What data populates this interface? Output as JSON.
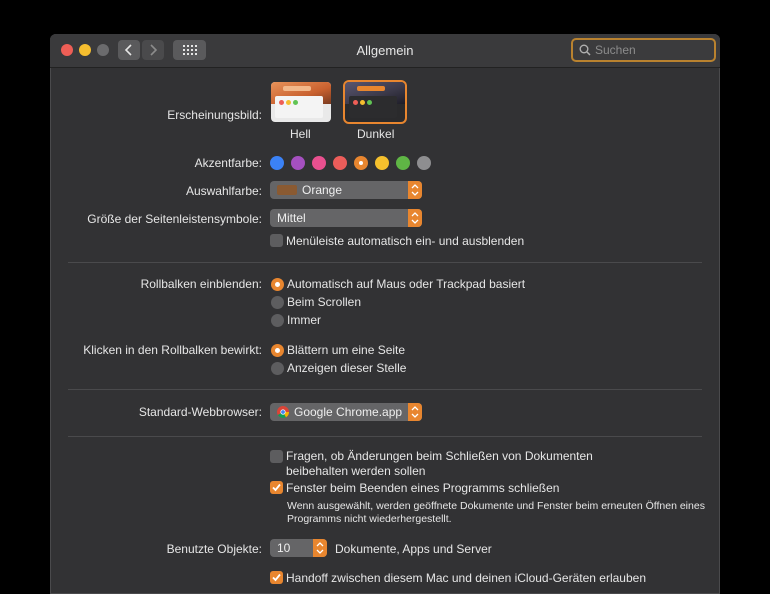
{
  "window": {
    "title": "Allgemein"
  },
  "search": {
    "placeholder": "Suchen"
  },
  "appearance": {
    "label": "Erscheinungsbild:",
    "options": [
      {
        "label": "Hell"
      },
      {
        "label": "Dunkel",
        "selected": true
      }
    ]
  },
  "accent": {
    "label": "Akzentfarbe:",
    "colors": [
      "#3b82f6",
      "#a550c0",
      "#e9508f",
      "#ec5d5a",
      "#e8862f",
      "#f5c02d",
      "#5fb645",
      "#8e8e90"
    ],
    "selected_color": "#e8862f"
  },
  "highlight": {
    "label": "Auswahlfarbe:",
    "value": "Orange",
    "swatch_color": "#8a5a32"
  },
  "sidebar_icons": {
    "label": "Größe der Seitenleistensymbole:",
    "value": "Mittel"
  },
  "menubar_autohide": {
    "label": "Menüleiste automatisch ein- und ausblenden",
    "checked": false
  },
  "show_scrollbars": {
    "label": "Rollbalken einblenden:",
    "options": [
      {
        "label": "Automatisch auf Maus oder Trackpad basiert",
        "selected": true
      },
      {
        "label": "Beim Scrollen",
        "selected": false
      },
      {
        "label": "Immer",
        "selected": false
      }
    ]
  },
  "click_scrollbar": {
    "label": "Klicken in den Rollbalken bewirkt:",
    "options": [
      {
        "label": "Blättern um eine Seite",
        "selected": true
      },
      {
        "label": "Anzeigen dieser Stelle",
        "selected": false
      }
    ]
  },
  "browser": {
    "label": "Standard-Webbrowser:",
    "value": "Google Chrome.app"
  },
  "ask_keep_changes": {
    "line1": "Fragen, ob Änderungen beim Schließen von Dokumenten",
    "line2": "beibehalten werden sollen",
    "checked": false
  },
  "close_windows": {
    "label": "Fenster beim Beenden eines Programms schließen",
    "checked": true,
    "note_line1": "Wenn ausgewählt, werden geöffnete Dokumente und Fenster beim erneuten Öffnen eines",
    "note_line2": "Programms nicht wiederhergestellt."
  },
  "recent_items": {
    "label": "Benutzte Objekte:",
    "value": "10",
    "suffix": "Dokumente, Apps und Server"
  },
  "handoff": {
    "label": "Handoff zwischen diesem Mac und deinen iCloud-Geräten erlauben",
    "checked": true
  },
  "colors": {
    "accent": "#e8862f",
    "window_bg": "#323234",
    "search_border": "#b9822f"
  }
}
